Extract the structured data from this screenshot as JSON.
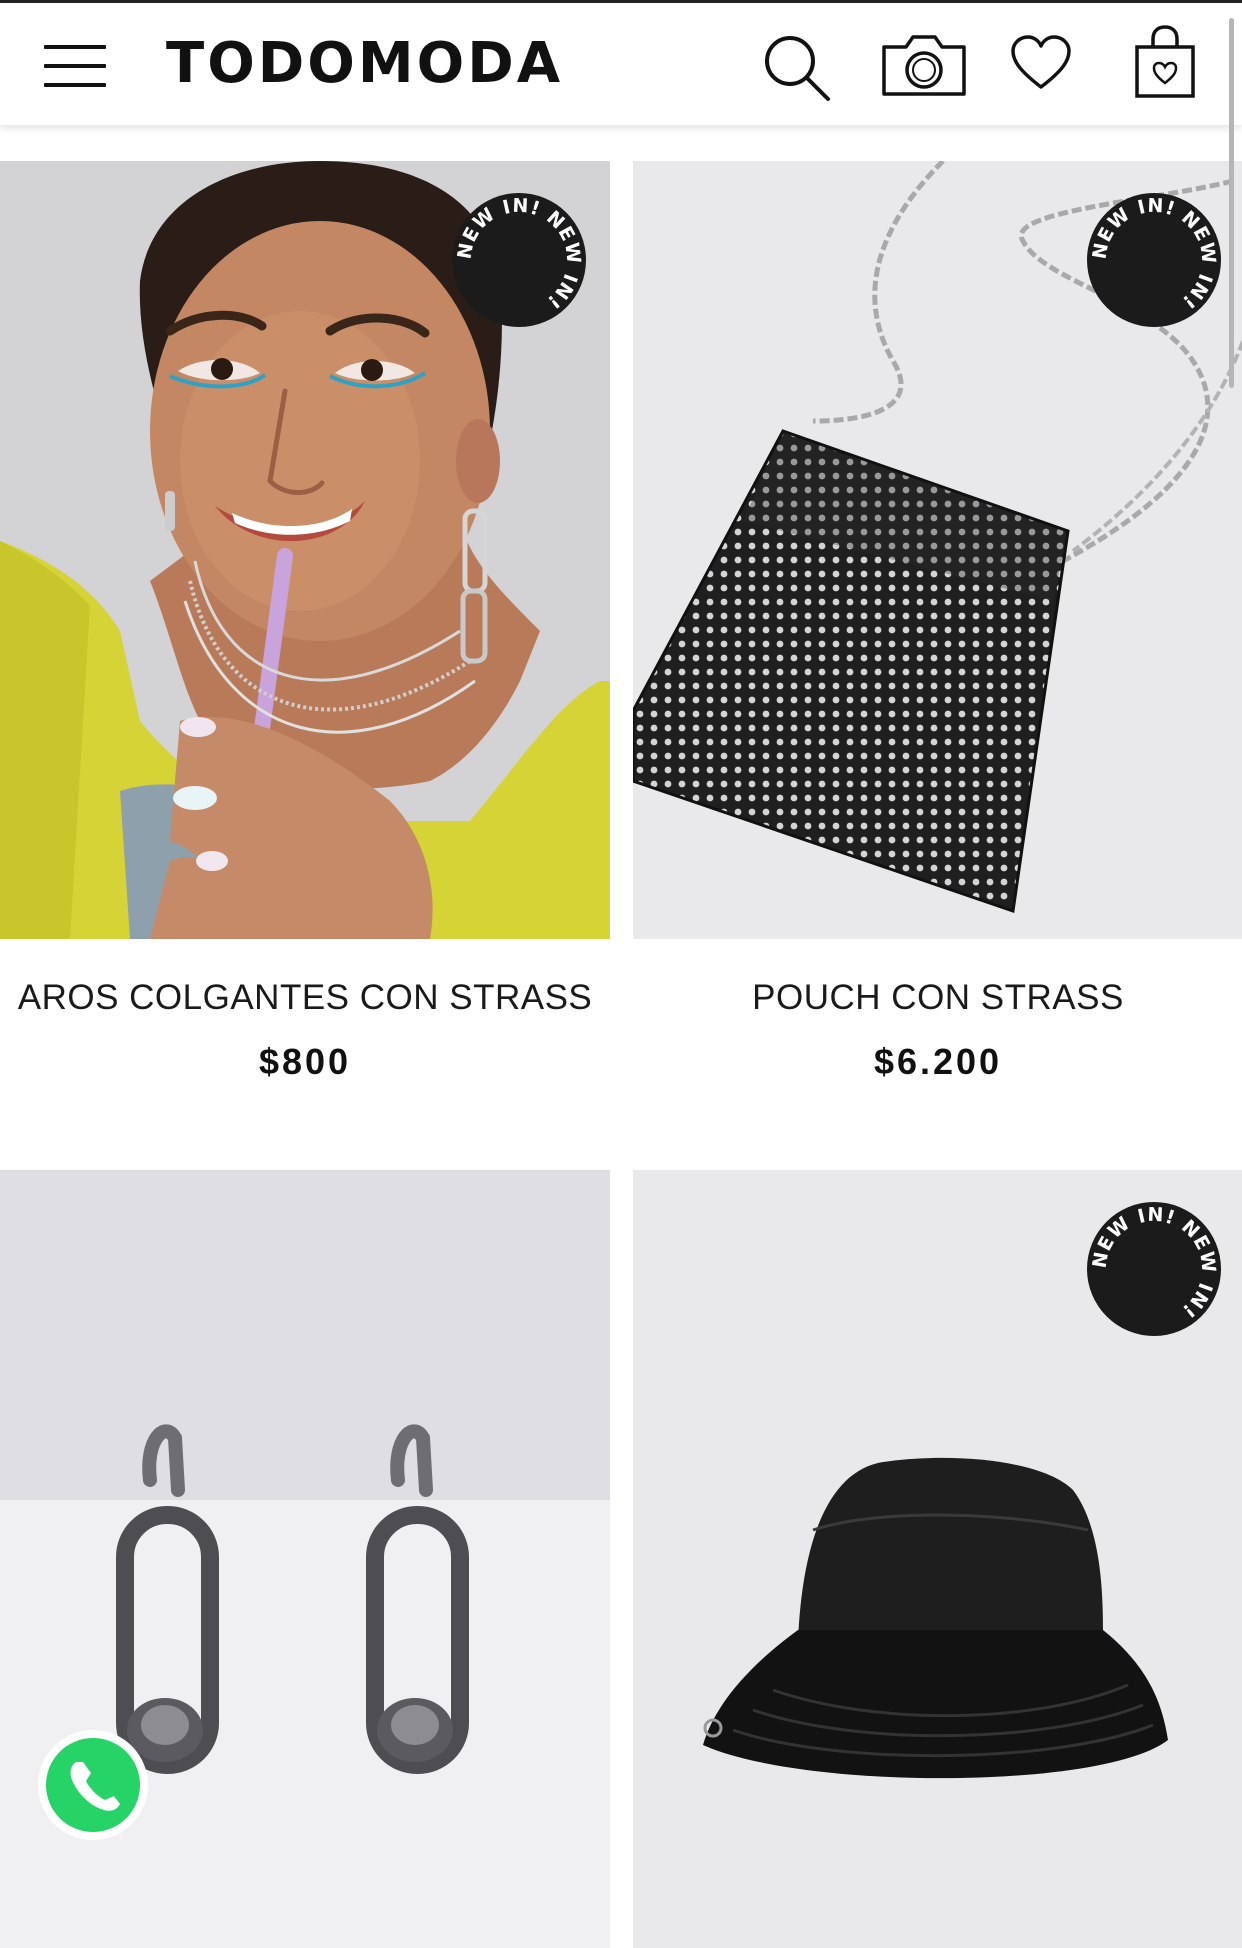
{
  "header": {
    "brand": "TODOMODA",
    "icons": [
      "menu-icon",
      "search-icon",
      "camera-icon",
      "heart-icon",
      "shopping-bag-icon"
    ]
  },
  "products": [
    {
      "name": "AROS COLGANTES CON STRASS",
      "price": "$800",
      "badge": "NEW IN!",
      "image": "model-wearing-earrings"
    },
    {
      "name": "POUCH CON STRASS",
      "price": "$6.200",
      "badge": "NEW IN!",
      "image": "rhinestone-pouch-with-chain"
    },
    {
      "name": "",
      "price": "",
      "image": "silver-link-earrings"
    },
    {
      "name": "",
      "price": "",
      "badge": "NEW IN!",
      "image": "black-bucket-hat"
    }
  ],
  "badge_text": "NEW IN! NEW IN! ",
  "floating": {
    "whatsapp_icon": "whatsapp-icon"
  },
  "colors": {
    "badge_bg": "#1b1b1b",
    "badge_text": "#ffffff",
    "whatsapp": "#25d366"
  }
}
